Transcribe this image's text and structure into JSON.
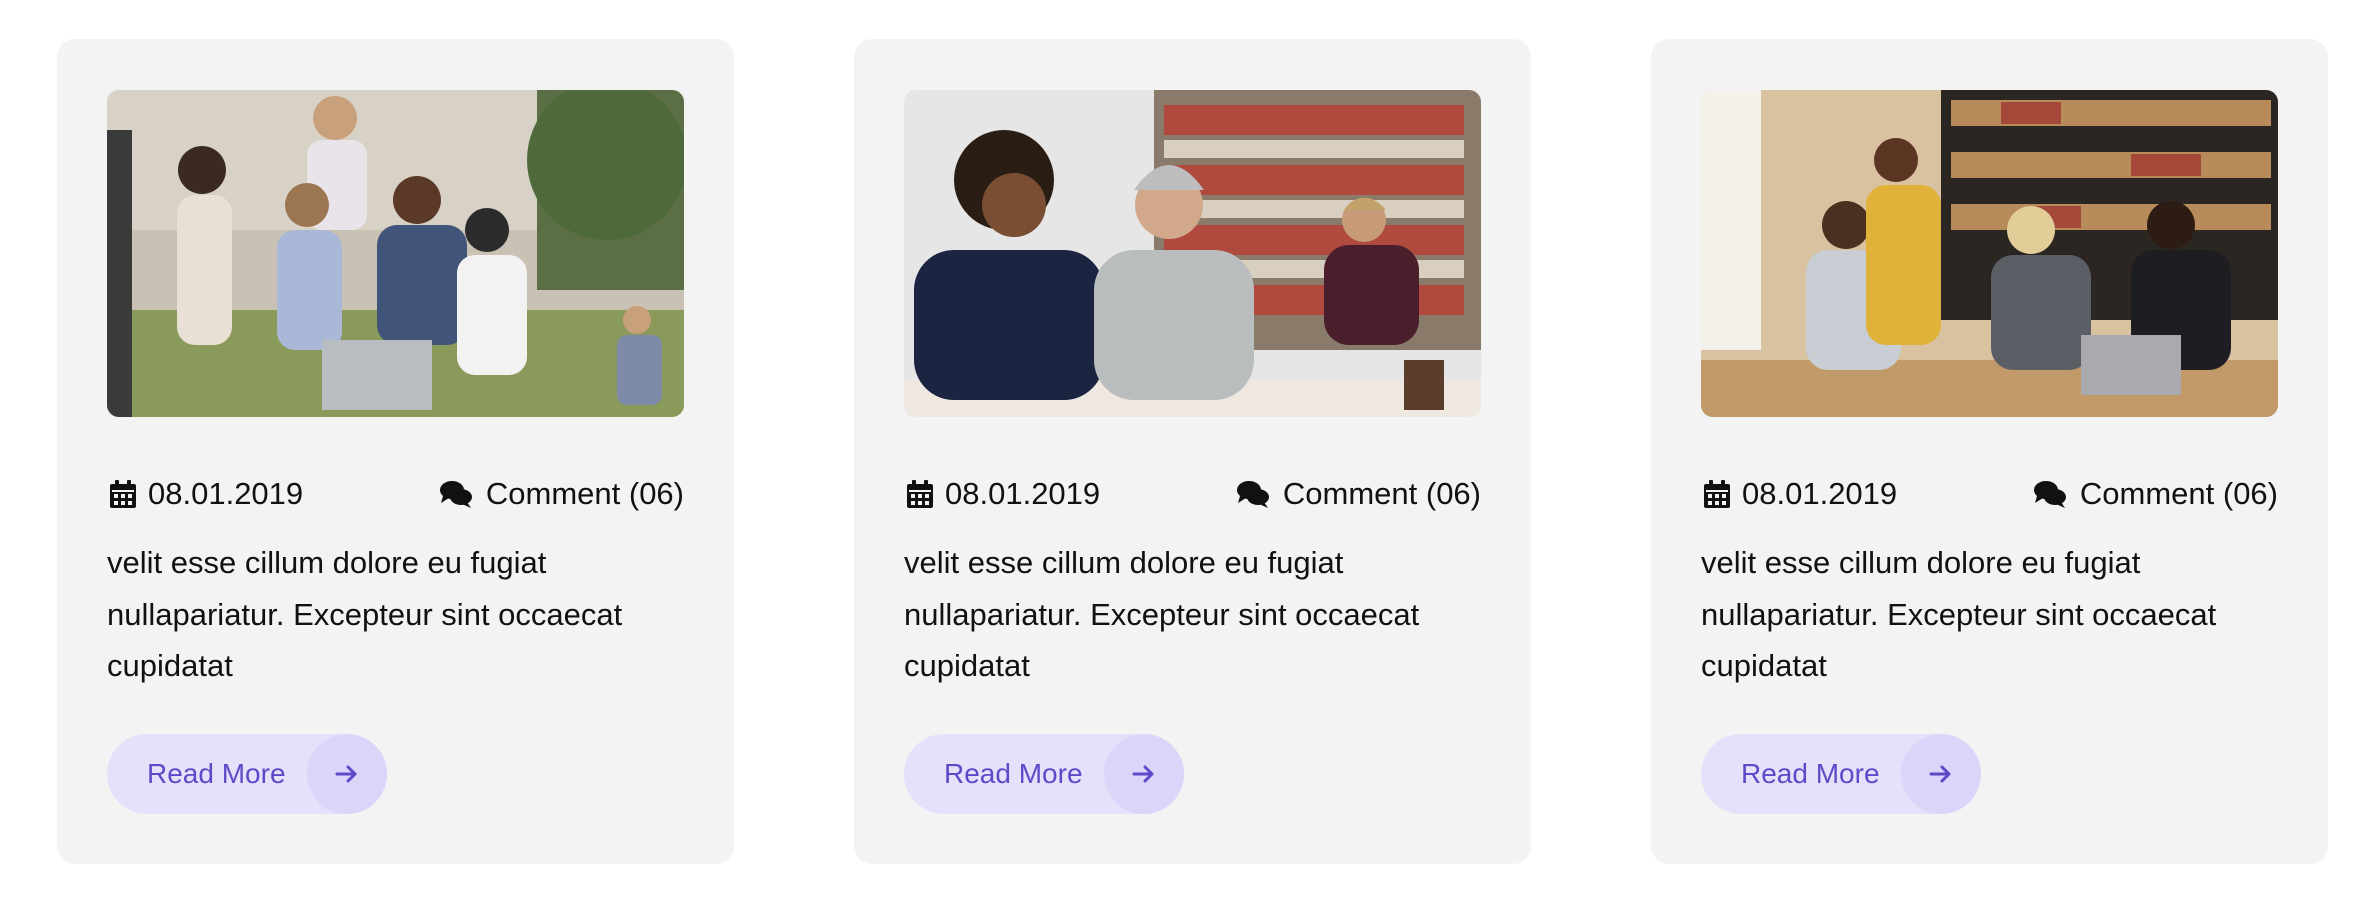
{
  "colors": {
    "card_background": "#f3f3f3",
    "button_background": "#e6e0fa",
    "button_text": "#6049c8",
    "text": "#111111"
  },
  "cards": [
    {
      "image": "students-outdoors-with-laptop-photo",
      "date_icon": "calendar-icon",
      "date": "08.01.2019",
      "comment_icon": "comments-icon",
      "comments": "Comment (06)",
      "excerpt": "velit esse cillum dolore eu fugiat nullapariatur. Excepteur sint occaecat cupidatat",
      "read_more": "Read More",
      "arrow_icon": "arrow-right-icon"
    },
    {
      "image": "student-and-teacher-in-library-photo",
      "date_icon": "calendar-icon",
      "date": "08.01.2019",
      "comment_icon": "comments-icon",
      "comments": "Comment (06)",
      "excerpt": "velit esse cillum dolore eu fugiat nullapariatur. Excepteur sint occaecat cupidatat",
      "read_more": "Read More",
      "arrow_icon": "arrow-right-icon"
    },
    {
      "image": "students-studying-at-table-photo",
      "date_icon": "calendar-icon",
      "date": "08.01.2019",
      "comment_icon": "comments-icon",
      "comments": "Comment (06)",
      "excerpt": "velit esse cillum dolore eu fugiat nullapariatur. Excepteur sint occaecat cupidatat",
      "read_more": "Read More",
      "arrow_icon": "arrow-right-icon"
    }
  ]
}
